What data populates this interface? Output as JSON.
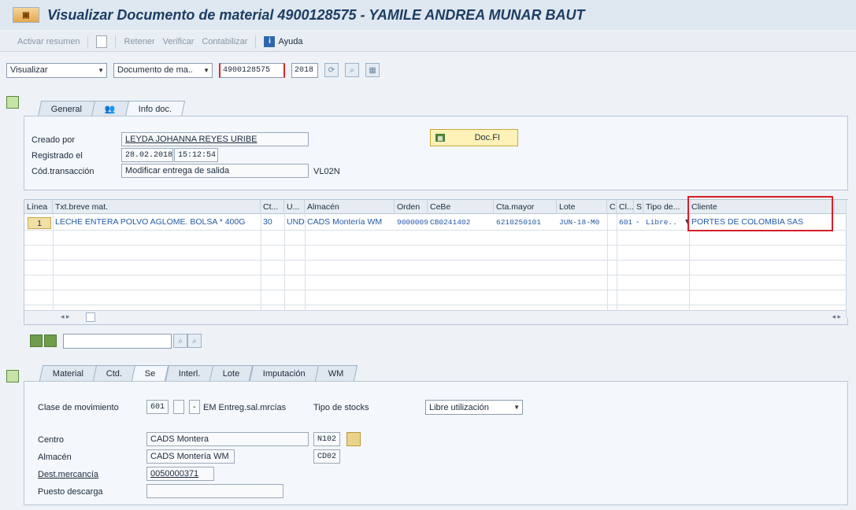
{
  "window": {
    "title": "Visualizar Documento de material 4900128575 - YAMILE ANDREA MUNAR BAUT"
  },
  "toolbar": {
    "activar_resumen": "Activar resumen",
    "retener": "Retener",
    "verificar": "Verificar",
    "contabilizar": "Contabilizar",
    "ayuda": "Ayuda"
  },
  "selection": {
    "mode": "Visualizar",
    "doc_type": "Documento de ma..",
    "doc_number": "4900128575",
    "year": "2018"
  },
  "header_tabs": [
    "General",
    "Info doc."
  ],
  "header": {
    "creado_por_label": "Creado por",
    "creado_por_value": "LEYDA JOHANNA REYES URIBE",
    "registrado_label": "Registrado el",
    "registrado_date": "28.02.2018",
    "registrado_time": "15:12:54",
    "cod_trans_label": "Cód.transacción",
    "cod_trans_value": "Modificar entrega de salida",
    "cod_trans_code": "VL02N",
    "docfi_label": "Doc.FI"
  },
  "table": {
    "columns": [
      "Línea",
      "Txt.breve mat.",
      "Ct...",
      "U...",
      "Almacén",
      "Orden",
      "CeBe",
      "Cta.mayor",
      "Lote",
      "C",
      "Cl...",
      "S",
      "Tipo de...",
      "Cliente"
    ],
    "row": {
      "linea": "1",
      "txt": "LECHE ENTERA POLVO AGLOME. BOLSA * 400G",
      "ct": "30",
      "u": "UND",
      "almacen": "CADS Montería WM",
      "orden": "9000009",
      "cebe": "CB0241402",
      "cta": "6210250101",
      "lote": "JUN-18-M0",
      "cl": "601",
      "s": "-",
      "tipo": "Libre..",
      "cliente": "PORTES DE COLOMBIA SAS"
    }
  },
  "item_tabs": [
    "Material",
    "Ctd.",
    "Se",
    "Interl.",
    "Lote",
    "Imputación",
    "WM"
  ],
  "item": {
    "clase_label": "Clase de movimiento",
    "clase_code": "601",
    "clase_sign": "-",
    "clase_text": "EM Entreg.sal.mrcías",
    "tipo_stock_label": "Tipo de stocks",
    "tipo_stock_value": "Libre utilización",
    "centro_label": "Centro",
    "centro_value": "CADS Montera",
    "centro_code": "N102",
    "almacen_label": "Almacén",
    "almacen_value": "CADS Montería WM",
    "almacen_code": "CD02",
    "dest_label": "Dest.mercancía",
    "dest_value": "0050000371",
    "puesto_label": "Puesto descarga"
  }
}
